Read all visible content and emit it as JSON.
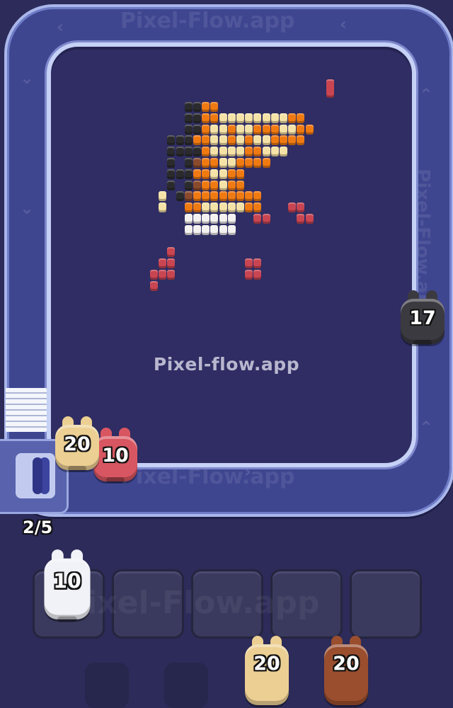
{
  "watermark": "Pixel-flow.app",
  "track_watermark_top": "Pixel-Flow.app",
  "track_watermark_bottom": "Pixel-Flow.app",
  "track_watermark_side": "Pixel-Flow.app",
  "slot_watermark": "Pixel-Flow.app",
  "queue_counter": "2/5",
  "colors": {
    "background": "#2c2b59",
    "board": "#2f2d63",
    "track": "#3f4690",
    "rail": "#c6d1f6",
    "orange": "#f07a12",
    "cream": "#f5e2a6",
    "white": "#f4f2f0",
    "black": "#2b2b2e",
    "red": "#c94552",
    "brown": "#8a4a2c",
    "tan": "#e6c688"
  },
  "shooters_on_track": [
    {
      "id": "black",
      "ammo": "17",
      "color": "#3a3a40"
    },
    {
      "id": "tan",
      "ammo": "20",
      "color": "#eccf92"
    },
    {
      "id": "red",
      "ammo": "10",
      "color": "#d85661"
    }
  ],
  "held_shooters": [
    {
      "id": "white",
      "ammo": "10",
      "color": "#f1f2f7"
    }
  ],
  "queue_shooters": [
    {
      "id": "tan",
      "ammo": "20",
      "color": "#eccf92"
    },
    {
      "id": "brown",
      "ammo": "20",
      "color": "#9a4e2e"
    }
  ],
  "slots": [
    "empty",
    "empty",
    "empty",
    "empty"
  ],
  "pixel_palette": [
    "#2b2b2e",
    "#8a4a2c",
    "#f07a12",
    "#f5e2a6",
    "#f4f2f0",
    "#c94552",
    "#e8c878"
  ]
}
